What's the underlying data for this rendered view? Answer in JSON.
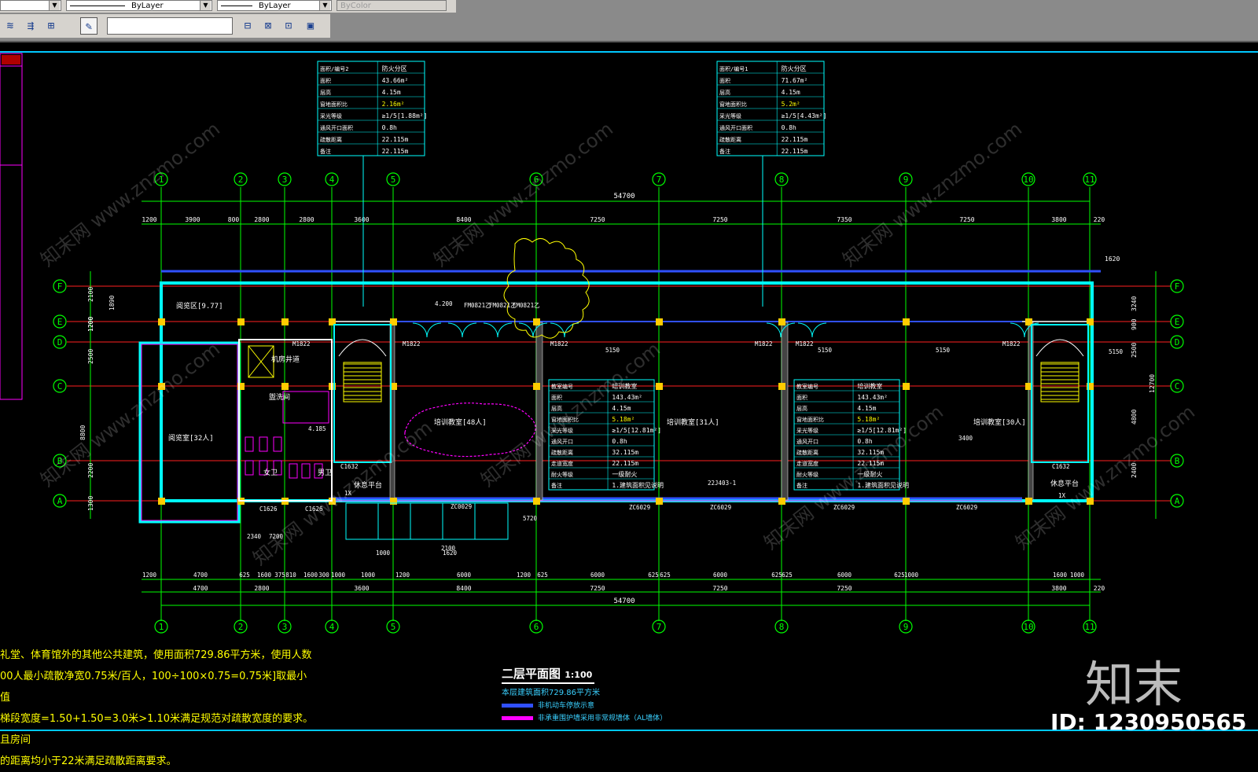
{
  "toolbar": {
    "combo_line_top": "",
    "linetype": "ByLayer",
    "lineweight": "ByLayer",
    "plotstyle": "ByColor"
  },
  "drawing": {
    "grid_columns": [
      "1",
      "2",
      "3",
      "4",
      "5",
      "6",
      "7",
      "8",
      "9",
      "10",
      "11"
    ],
    "grid_rows": [
      "F",
      "E",
      "D",
      "C",
      "B",
      "A"
    ],
    "overall_dim": "54700",
    "top_dims": [
      "1200",
      "3900",
      "800",
      "2800",
      "2800",
      "3600",
      "8400",
      "7250",
      "7250",
      "7350",
      "7250",
      "3800",
      "220"
    ],
    "bottom_dims_outer": [
      "1200",
      "4700",
      "625",
      "1600",
      "375",
      "810",
      "1600",
      "300",
      "1000",
      "1000",
      "1200",
      "6000",
      "1200",
      "625",
      "6000",
      "625",
      "625",
      "6000",
      "625",
      "625",
      "6000",
      "625",
      "1000",
      "1600",
      "1000"
    ],
    "bottom_dims_mid": [
      "4700",
      "2800",
      "3600",
      "8400",
      "7250",
      "7250",
      "7250",
      "3800",
      "220"
    ],
    "right_dims": [
      "1620",
      "3240",
      "900",
      "2500",
      "4800",
      "2400",
      "12700"
    ],
    "left_dims": [
      "2100",
      "1890",
      "1200",
      "2500",
      "1200",
      "8800",
      "2200",
      "1300"
    ],
    "room_labels": [
      "阅览区[9.77]",
      "阅览室[32人]",
      "培训教室[48人]",
      "培训教室[31人]",
      "培训教室[30人]",
      "休息平台",
      "休息平台",
      "盥洗间",
      "女卫",
      "男卫",
      "机房井道"
    ],
    "misc_labels": [
      "M1822",
      "M1822",
      "M1822",
      "M1822",
      "M1822",
      "M1822",
      "ZC0029",
      "ZC6029",
      "ZC6029",
      "ZC6029",
      "ZC6029",
      "C1632",
      "C1632",
      "C1626",
      "C1626",
      "FM0821乙",
      "FM0821乙",
      "FM0821乙",
      "22J403-1",
      "4.200",
      "4.185",
      "1X",
      "1X",
      "5150",
      "5150",
      "5150",
      "5150",
      "3400",
      "7200",
      "2340",
      "1000",
      "1620",
      "5720",
      "2100"
    ],
    "table_top_left": {
      "rows": [
        [
          "面积/编号2",
          "防火分区"
        ],
        [
          "面积",
          "43.66m²"
        ],
        [
          "层高",
          "4.15m"
        ],
        [
          "窗地面积比",
          "2.16m²"
        ],
        [
          "采光等级",
          "≥1/5[1.88m²]"
        ],
        [
          "通风开口面积",
          "0.8h"
        ],
        [
          "疏散距离",
          "22.115m"
        ],
        [
          "备注",
          "22.115m"
        ]
      ]
    },
    "table_top_right": {
      "rows": [
        [
          "面积/编号1",
          "防火分区"
        ],
        [
          "面积",
          "71.67m²"
        ],
        [
          "层高",
          "4.15m"
        ],
        [
          "窗地面积比",
          "5.2m²"
        ],
        [
          "采光等级",
          "≥1/5[4.43m²]"
        ],
        [
          "通风开口面积",
          "0.8h"
        ],
        [
          "疏散距离",
          "22.115m"
        ],
        [
          "备注",
          "22.115m"
        ]
      ]
    },
    "table_mid_left": {
      "rows": [
        [
          "教室编号",
          "培训教室"
        ],
        [
          "面积",
          "143.43m²"
        ],
        [
          "层高",
          "4.15m"
        ],
        [
          "窗地面积比",
          "5.18m²"
        ],
        [
          "采光等级",
          "≥1/5[12.81m²]"
        ],
        [
          "通风开口",
          "0.8h"
        ],
        [
          "疏散距离",
          "32.115m"
        ],
        [
          "走道宽度",
          "22.115m"
        ],
        [
          "耐火等级",
          "一级耐火"
        ],
        [
          "备注",
          "1.建筑面积见说明"
        ]
      ]
    },
    "table_mid_right": {
      "rows": [
        [
          "教室编号",
          "培训教室"
        ],
        [
          "面积",
          "143.43m²"
        ],
        [
          "层高",
          "4.15m"
        ],
        [
          "窗地面积比",
          "5.18m²"
        ],
        [
          "采光等级",
          "≥1/5[12.81m²]"
        ],
        [
          "通风开口",
          "0.8h"
        ],
        [
          "疏散距离",
          "32.115m"
        ],
        [
          "走道宽度",
          "22.115m"
        ],
        [
          "耐火等级",
          "一级耐火"
        ],
        [
          "备注",
          "1.建筑面积见说明"
        ]
      ]
    }
  },
  "notes": [
    "礼堂、体育馆外的其他公共建筑，使用面积729.86平方米，使用人数",
    "00人最小疏散净宽0.75米/百人，100÷100×0.75=0.75米]取最小值",
    "梯段宽度=1.50+1.50=3.0米>1.10米满足规范对疏散宽度的要求。且房间",
    "的距离均小于22米满足疏散距离要求。"
  ],
  "title_block": {
    "title": "二层平面图",
    "scale": "1:100",
    "subtitle": "本层建筑面积729.86平方米",
    "legend1": "非机动车停放示意",
    "legend2": "非承重围护墙采用非常规墙体（AL墙体）"
  },
  "watermark": {
    "logo": "知末",
    "id": "ID: 1230950565",
    "site": "www.znzmo.com",
    "site_cn": "知末网"
  },
  "colors": {
    "background": "#000000",
    "grid_green": "#00ff00",
    "wall_cyan": "#00ffff",
    "axis_red": "#ff2020",
    "window_blue": "#3050ff",
    "magenta": "#ff00ff",
    "yellow": "#ffff00",
    "text_white": "#ffffff"
  }
}
